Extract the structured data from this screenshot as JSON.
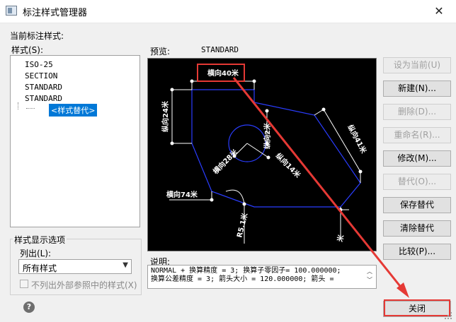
{
  "window": {
    "title": "标注样式管理器",
    "close_glyph": "✕"
  },
  "labels": {
    "current_style": "当前标注样式:",
    "styles": "样式(S):",
    "preview": "预览:",
    "preview_style": "STANDARD",
    "description": "说明:"
  },
  "style_list": {
    "items": [
      "ISO-25",
      "SECTION",
      "STANDARD",
      "STANDARD"
    ],
    "selected": "<样式替代>"
  },
  "display_options": {
    "legend": "样式显示选项",
    "list_label": "列出(L):",
    "list_value": "所有样式",
    "exclude_xrefs": "不列出外部参照中的样式(X)"
  },
  "description_text": {
    "line1": "NORMAL + 换算精度 = 3; 换算子零因子= 100.000000;",
    "line2": "换算公差精度 = 3; 箭头大小  = 120.000000; 箭头 ="
  },
  "buttons": {
    "set_current": "设为当前(U)",
    "new": "新建(N)...",
    "delete": "删除(D)...",
    "rename": "重命名(R)...",
    "modify": "修改(M)...",
    "override": "替代(O)...",
    "save_override": "保存替代",
    "clear_override": "清除替代",
    "compare": "比较(P)...",
    "close": "关闭"
  },
  "preview_dims": {
    "top": "横向40米",
    "left": "纵向24米",
    "center": "纵向2米",
    "diag1": "横向28米",
    "diag2": "纵向14米",
    "right": "纵向41米",
    "bottom_left": "横向74米",
    "bottom_mid": "R5.1米",
    "bottom_right": "米"
  },
  "colors": {
    "accent": "#e53935",
    "selection": "#0078d7",
    "shape": "#2a3dff"
  }
}
